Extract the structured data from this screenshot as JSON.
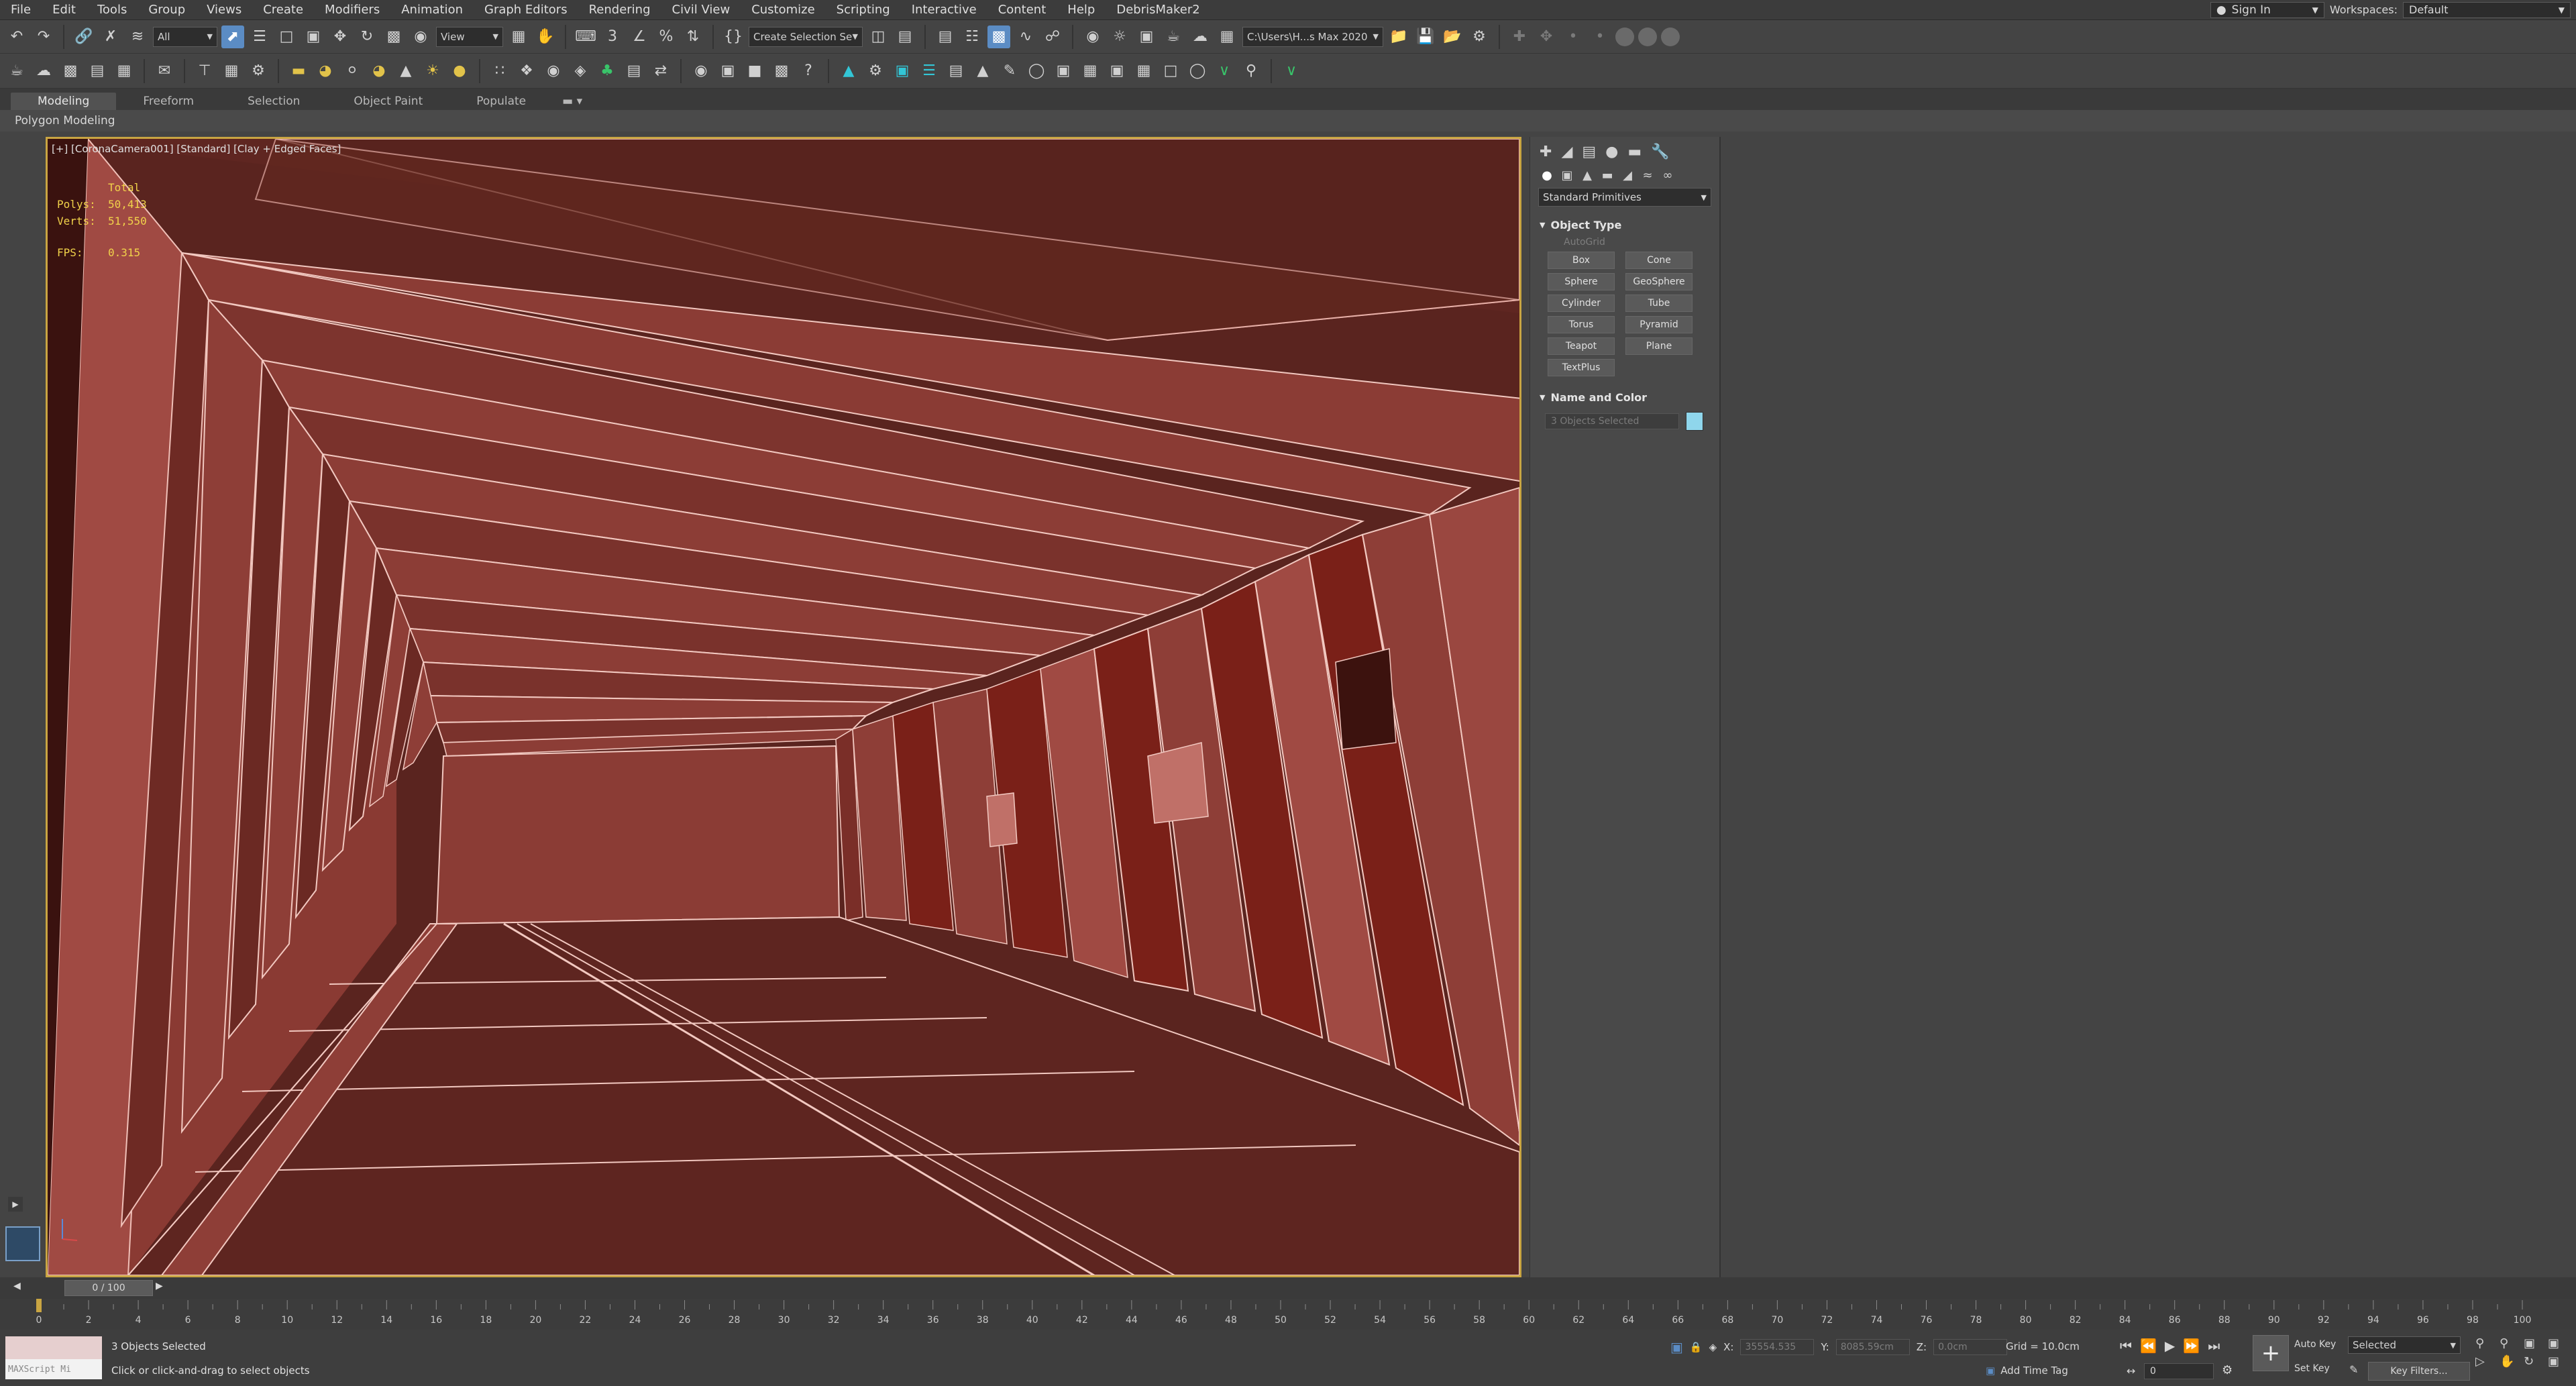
{
  "menu": [
    "File",
    "Edit",
    "Tools",
    "Group",
    "Views",
    "Create",
    "Modifiers",
    "Animation",
    "Graph Editors",
    "Rendering",
    "Civil View",
    "Customize",
    "Scripting",
    "Interactive",
    "Content",
    "Help",
    "DebrisMaker2"
  ],
  "signin": {
    "label": "Sign In"
  },
  "workspaces": {
    "label": "Workspaces:",
    "value": "Default"
  },
  "toolbar": {
    "filter_value": "All",
    "ref_coord_value": "View",
    "selection_set_placeholder": "Create Selection Se",
    "project_path": "C:\\Users\\H...s Max 2020"
  },
  "ribbon": {
    "tabs": [
      "Modeling",
      "Freeform",
      "Selection",
      "Object Paint",
      "Populate"
    ],
    "active": "Modeling",
    "subtab": "Polygon Modeling"
  },
  "viewport": {
    "label": "[+] [CoronaCamera001] [Standard] [Clay + Edged Faces]",
    "stats": {
      "total_label": "Total",
      "polys_label": "Polys:",
      "polys": "50,413",
      "verts_label": "Verts:",
      "verts": "51,550",
      "fps_label": "FPS:",
      "fps": "0.315"
    }
  },
  "command_panel": {
    "category": "Standard Primitives",
    "object_type_title": "Object Type",
    "autogrid": "AutoGrid",
    "primitives": [
      "Box",
      "Cone",
      "Sphere",
      "GeoSphere",
      "Cylinder",
      "Tube",
      "Torus",
      "Pyramid",
      "Teapot",
      "Plane",
      "TextPlus"
    ],
    "name_color_title": "Name and Color",
    "name_placeholder": "3 Objects Selected",
    "color": "#8fd6ec"
  },
  "timeline": {
    "frame_display": "0 / 100",
    "ticks": [
      "0",
      "2",
      "4",
      "6",
      "8",
      "10",
      "12",
      "14",
      "16",
      "18",
      "20",
      "22",
      "24",
      "26",
      "28",
      "30",
      "32",
      "34",
      "36",
      "38",
      "40",
      "42",
      "44",
      "46",
      "48",
      "50",
      "52",
      "54",
      "56",
      "58",
      "60",
      "62",
      "64",
      "66",
      "68",
      "70",
      "72",
      "74",
      "76",
      "78",
      "80",
      "82",
      "84",
      "86",
      "88",
      "90",
      "92",
      "94",
      "96",
      "98",
      "100"
    ]
  },
  "status": {
    "maxscript_label": "MAXScript Mi",
    "selection_info": "3 Objects Selected",
    "prompt": "Click or click-and-drag to select objects",
    "x_label": "X:",
    "x_value": "35554.535",
    "y_label": "Y:",
    "y_value": "8085.59cm",
    "z_label": "Z:",
    "z_value": "0.0cm",
    "grid": "Grid = 10.0cm",
    "add_time_tag": "Add Time Tag",
    "current_frame": "0",
    "auto_key": "Auto Key",
    "set_key": "Set Key",
    "key_mode": "Selected",
    "key_filters": "Key Filters..."
  }
}
